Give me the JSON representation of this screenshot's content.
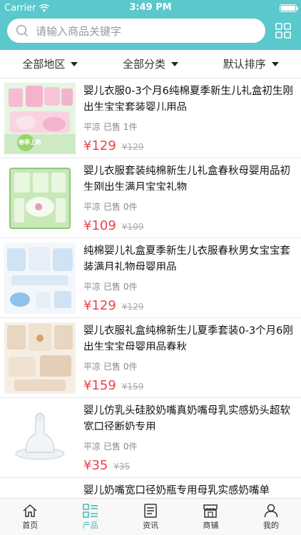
{
  "status": {
    "carrier": "Carrier",
    "time": "3:49 PM"
  },
  "search": {
    "placeholder": "请输入商品关键字"
  },
  "filters": [
    {
      "label": "全部地区"
    },
    {
      "label": "全部分类"
    },
    {
      "label": "默认排序"
    }
  ],
  "products": [
    {
      "title": "婴儿衣服0-3个月6纯棉夏季新生儿礼盒初生刚出生宝宝套装婴儿用品",
      "location": "平凉",
      "sold": "已售 1件",
      "price": "¥129",
      "old_price": "¥129"
    },
    {
      "title": "婴儿衣服套装纯棉新生儿礼盒春秋母婴用品初生刚出生满月宝宝礼物",
      "location": "平凉",
      "sold": "已售 0件",
      "price": "¥109",
      "old_price": "¥109"
    },
    {
      "title": "纯棉婴儿礼盒夏季新生儿衣服春秋男女宝宝套装满月礼物母婴用品",
      "location": "平凉",
      "sold": "已售 0件",
      "price": "¥129",
      "old_price": "¥129"
    },
    {
      "title": "婴儿衣服礼盒纯棉新生儿夏季套装0-3个月6刚出生宝宝母婴用品春秋",
      "location": "平凉",
      "sold": "已售 0件",
      "price": "¥159",
      "old_price": "¥159"
    },
    {
      "title": "婴儿仿乳头硅胶奶嘴真奶嘴母乳实感奶头超软宽口径断奶专用",
      "location": "平凉",
      "sold": "已售 0件",
      "price": "¥35",
      "old_price": "¥35"
    },
    {
      "title": "婴儿奶嘴宽口径奶瓶专用母乳实感奶嘴单",
      "location": "",
      "sold": "",
      "price": "",
      "old_price": ""
    }
  ],
  "thumb_badge": "春季上新",
  "tabs": [
    {
      "label": "首页",
      "icon": "home-icon"
    },
    {
      "label": "产品",
      "icon": "list-icon",
      "active": true
    },
    {
      "label": "资讯",
      "icon": "news-icon"
    },
    {
      "label": "商铺",
      "icon": "shop-icon"
    },
    {
      "label": "我的",
      "icon": "user-icon"
    }
  ],
  "colors": {
    "header": "#5ac8cc",
    "price": "#e8454d",
    "active_tab": "#3fb6bb"
  }
}
